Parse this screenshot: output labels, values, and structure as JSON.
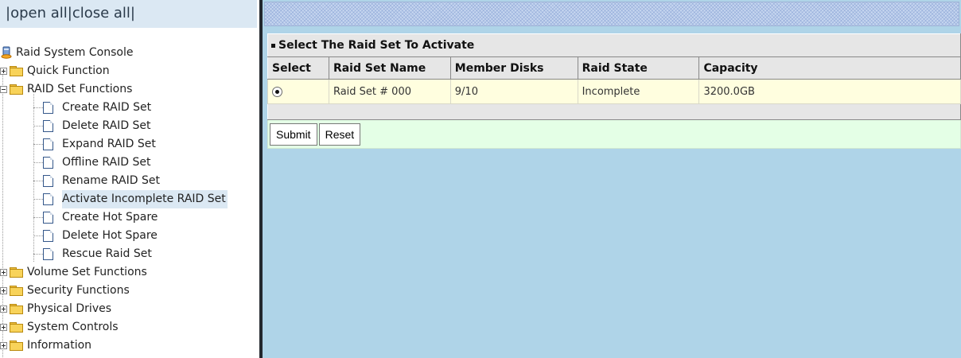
{
  "topbar": {
    "open_all": "|open all",
    "close_all": "|close all|"
  },
  "tree": {
    "root": "Raid System Console",
    "quick": "Quick Function",
    "raid_set": {
      "label": "RAID Set Functions",
      "children": [
        "Create RAID Set",
        "Delete RAID Set",
        "Expand RAID Set",
        "Offline RAID Set",
        "Rename RAID Set",
        "Activate Incomplete RAID Set",
        "Create Hot Spare",
        "Delete Hot Spare",
        "Rescue Raid Set"
      ]
    },
    "volume": "Volume Set Functions",
    "security": "Security Functions",
    "physical": "Physical Drives",
    "system": "System Controls",
    "info": "Information"
  },
  "panel": {
    "title": "Select The Raid Set To Activate",
    "headers": [
      "Select",
      "Raid Set Name",
      "Member Disks",
      "Raid State",
      "Capacity"
    ],
    "rows": [
      {
        "name": "Raid Set # 000",
        "disks": "9/10",
        "state": "Incomplete",
        "capacity": "3200.0GB",
        "selected": true
      }
    ],
    "submit": "Submit",
    "reset": "Reset"
  },
  "colors": {
    "tree_selected": "#dbe8f3",
    "content_bg": "#afd4e8",
    "button_row_bg": "#e4ffe6",
    "data_row_bg": "#fffedf"
  }
}
